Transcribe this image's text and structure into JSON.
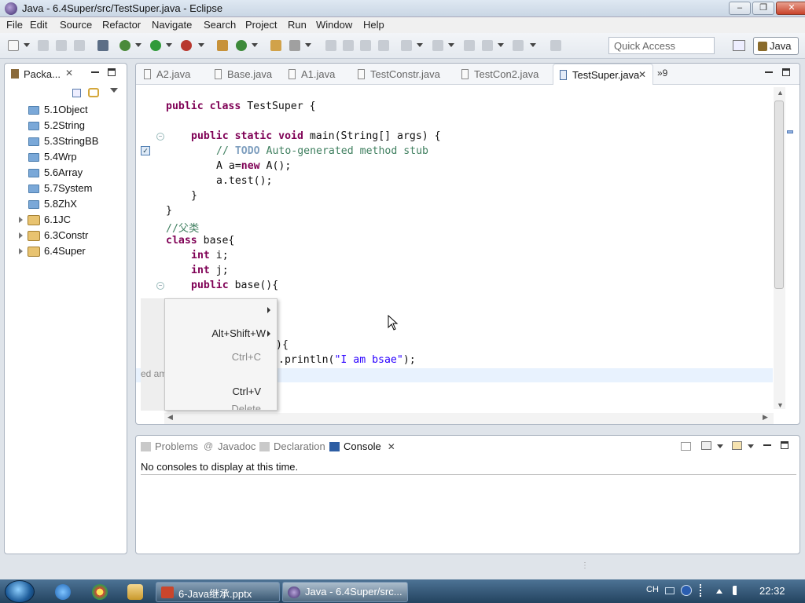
{
  "window": {
    "title": "Java - 6.4Super/src/TestSuper.java - Eclipse",
    "controls": [
      "‒",
      "❐",
      "✕"
    ]
  },
  "menu": [
    "File",
    "Edit",
    "Source",
    "Refactor",
    "Navigate",
    "Search",
    "Project",
    "Run",
    "Window",
    "Help"
  ],
  "toolbar": {
    "quick_access_placeholder": "Quick Access",
    "perspective": "Java"
  },
  "package_explorer": {
    "tab_label": "Packa...",
    "close": "✕",
    "items": [
      {
        "label": "5.1Object",
        "kind": "package"
      },
      {
        "label": "5.2String",
        "kind": "package"
      },
      {
        "label": "5.3StringBB",
        "kind": "package"
      },
      {
        "label": "5.4Wrp",
        "kind": "package"
      },
      {
        "label": "5.6Array",
        "kind": "package"
      },
      {
        "label": "5.7System",
        "kind": "package"
      },
      {
        "label": "5.8ZhX",
        "kind": "package"
      },
      {
        "label": "6.1JC",
        "kind": "project"
      },
      {
        "label": "6.3Constr",
        "kind": "project"
      },
      {
        "label": "6.4Super",
        "kind": "project"
      }
    ]
  },
  "editor": {
    "tabs": [
      {
        "label": "A2.java",
        "active": false
      },
      {
        "label": "Base.java",
        "active": false
      },
      {
        "label": "A1.java",
        "active": false
      },
      {
        "label": "TestConstr.java",
        "active": false
      },
      {
        "label": "TestCon2.java",
        "active": false
      },
      {
        "label": "TestSuper.java",
        "active": true
      }
    ],
    "overflow_label": "»9",
    "code": {
      "l1": {
        "kw": "public class",
        "rest": " TestSuper {"
      },
      "l2": {
        "kw": "public static void",
        "rest": " main(String[] args) {"
      },
      "l3": {
        "comment": "// ",
        "todo": "TODO",
        "comment2": " Auto-generated method stub"
      },
      "l4": {
        "a": "A a=",
        "kw": "new",
        "b": " A();"
      },
      "l5": "a.test();",
      "l6": "}",
      "l7": "}",
      "l8": "//父类",
      "l9": {
        "kw": "class",
        "rest": " base{"
      },
      "l10": {
        "kw": "int",
        "rest": " i;"
      },
      "l11": {
        "kw": "int",
        "rest": " j;"
      },
      "l12": {
        "kw": "public",
        "rest": " base(){"
      },
      "l13_partial": "){",
      "l14": {
        "pre": ".println(",
        "str": "\"I am bsae\"",
        "post": ");"
      }
    }
  },
  "context_menu": {
    "row1_label": "",
    "row2_shortcut": "Alt+Shift+W",
    "row3_shortcut": "Ctrl+C",
    "row4_shortcut": "Ctrl+V",
    "row5_label": "Delete",
    "leaked_text": "ed ame"
  },
  "bottom_panel": {
    "tabs": [
      "Problems",
      "Javadoc",
      "Declaration",
      "Console"
    ],
    "active_tab": "Console",
    "message": "No consoles to display at this time."
  },
  "taskbar": {
    "tasks": [
      {
        "label": "6-Java继承.pptx"
      },
      {
        "label": "Java - 6.4Super/src..."
      }
    ],
    "tray_lang": "CH",
    "clock": "22:32"
  }
}
